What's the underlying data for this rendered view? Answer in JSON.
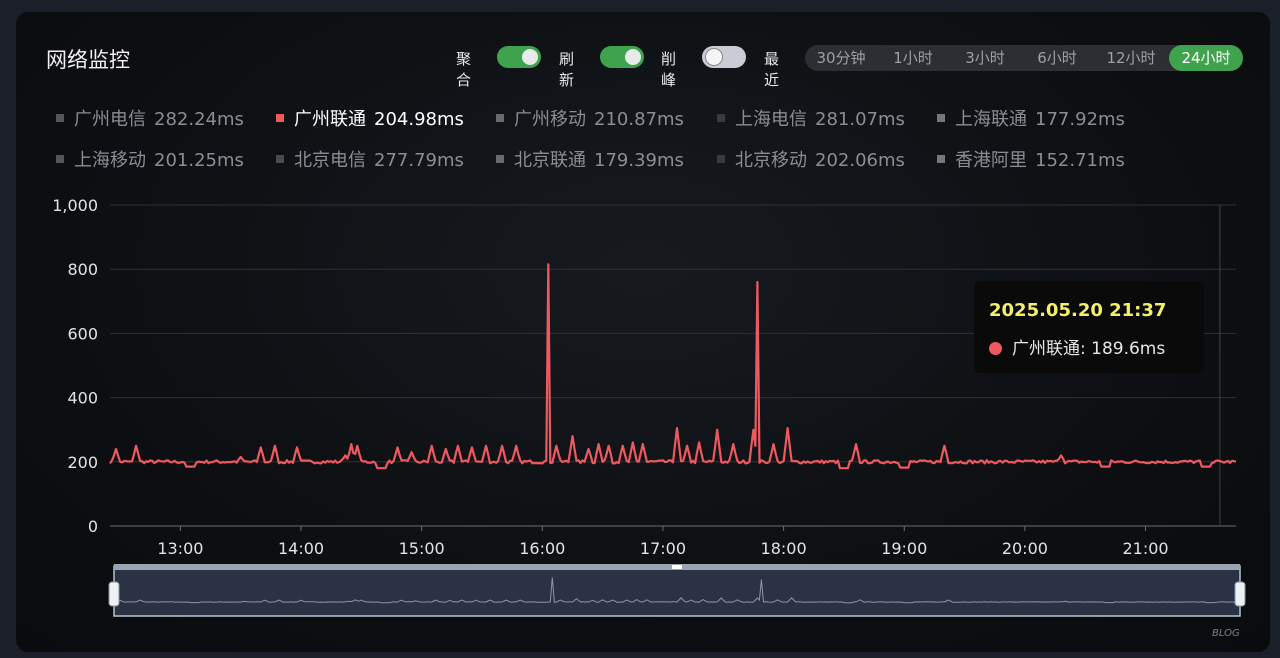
{
  "panel": {
    "title": "网络监控"
  },
  "controls": {
    "aggregate": {
      "label": "聚合",
      "on": true
    },
    "refresh": {
      "label": "刷新",
      "on": true
    },
    "peak_clip": {
      "label": "削峰",
      "on": false
    },
    "recent_label": "最近",
    "ranges": [
      "30分钟",
      "1小时",
      "3小时",
      "6小时",
      "12小时",
      "24小时"
    ],
    "active_range": "24小时"
  },
  "legend": [
    {
      "name": "广州电信",
      "value": "282.24ms",
      "active": false
    },
    {
      "name": "广州联通",
      "value": "204.98ms",
      "active": true
    },
    {
      "name": "广州移动",
      "value": "210.87ms",
      "active": false
    },
    {
      "name": "上海电信",
      "value": "281.07ms",
      "active": false
    },
    {
      "name": "上海联通",
      "value": "177.92ms",
      "active": false
    },
    {
      "name": "上海移动",
      "value": "201.25ms",
      "active": false
    },
    {
      "name": "北京电信",
      "value": "277.79ms",
      "active": false
    },
    {
      "name": "北京联通",
      "value": "179.39ms",
      "active": false
    },
    {
      "name": "北京移动",
      "value": "202.06ms",
      "active": false
    },
    {
      "name": "香港阿里",
      "value": "152.71ms",
      "active": false
    }
  ],
  "tooltip": {
    "time": "2025.05.20 21:37",
    "series": "广州联通",
    "value_text": "189.6ms"
  },
  "watermark": "BLOG",
  "colors": {
    "accent_green": "#3fa34d",
    "series_line": "#f0585f",
    "tooltip_time": "#f4f06a",
    "grid": "#2e3136",
    "swatch_active": "#f0585f",
    "swatch_inactive": [
      "#555555",
      "#4a4a4a",
      "#6a6a6a",
      "#3a3a3a",
      "#777777"
    ]
  },
  "chart_data": {
    "type": "line",
    "x_unit": "time",
    "x_range": [
      "12:25",
      "21:45"
    ],
    "x_ticks": [
      "13:00",
      "14:00",
      "15:00",
      "16:00",
      "17:00",
      "18:00",
      "19:00",
      "20:00",
      "21:00"
    ],
    "y_ticks": [
      "0",
      "200",
      "400",
      "600",
      "800",
      "1,000"
    ],
    "ylim": [
      0,
      1000
    ],
    "grid": true,
    "cursor_x": "21:37",
    "series": [
      {
        "name": "广州联通",
        "baseline": 200,
        "spikes": [
          [
            "12:28",
            240
          ],
          [
            "12:38",
            250
          ],
          [
            "13:30",
            215
          ],
          [
            "13:40",
            245
          ],
          [
            "13:47",
            250
          ],
          [
            "13:58",
            245
          ],
          [
            "14:22",
            220
          ],
          [
            "14:25",
            255
          ],
          [
            "14:28",
            250
          ],
          [
            "14:48",
            245
          ],
          [
            "14:55",
            230
          ],
          [
            "15:05",
            250
          ],
          [
            "15:12",
            240
          ],
          [
            "15:18",
            250
          ],
          [
            "15:25",
            245
          ],
          [
            "15:32",
            250
          ],
          [
            "15:40",
            250
          ],
          [
            "15:47",
            250
          ],
          [
            "16:03",
            815
          ],
          [
            "16:07",
            250
          ],
          [
            "16:15",
            280
          ],
          [
            "16:23",
            240
          ],
          [
            "16:28",
            255
          ],
          [
            "16:33",
            250
          ],
          [
            "16:40",
            250
          ],
          [
            "16:45",
            260
          ],
          [
            "16:50",
            255
          ],
          [
            "17:07",
            305
          ],
          [
            "17:12",
            250
          ],
          [
            "17:18",
            260
          ],
          [
            "17:27",
            300
          ],
          [
            "17:35",
            255
          ],
          [
            "17:45",
            300
          ],
          [
            "17:47",
            760
          ],
          [
            "17:55",
            255
          ],
          [
            "18:02",
            305
          ],
          [
            "18:36",
            255
          ],
          [
            "19:20",
            250
          ],
          [
            "20:18",
            220
          ]
        ],
        "dips": [
          [
            "13:05",
            185
          ],
          [
            "14:40",
            180
          ],
          [
            "18:30",
            180
          ],
          [
            "19:00",
            182
          ],
          [
            "20:40",
            185
          ],
          [
            "21:30",
            185
          ]
        ]
      }
    ]
  }
}
